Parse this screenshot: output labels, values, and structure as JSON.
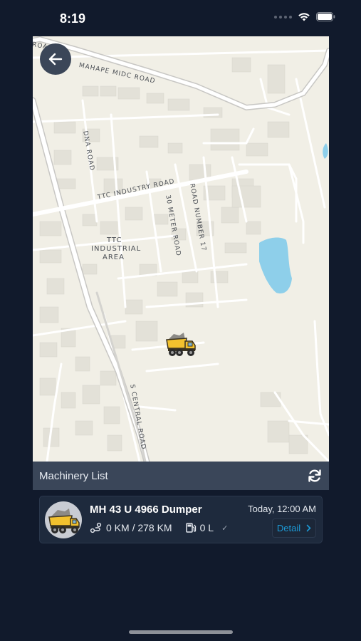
{
  "status_bar": {
    "time": "8:19"
  },
  "map": {
    "labels": {
      "top_road": "ROA",
      "mahape": "MAHAPE MIDC ROAD",
      "dna": "DNA ROAD",
      "ttc_industry": "TTC INDUSTRY ROAD",
      "thirty_meter": "30 METER ROAD",
      "road_17": "ROAD NUMBER 17",
      "area_line1": "TTC",
      "area_line2": "INDUSTRIAL",
      "area_line3": "AREA",
      "s_central": "S CENTRAL ROAD"
    },
    "marker_icon": "dumper-truck-icon"
  },
  "machinery_list": {
    "title": "Machinery List",
    "refresh_icon": "refresh-icon"
  },
  "machines": [
    {
      "name": "MH 43 U 4966 Dumper",
      "time": "Today, 12:00 AM",
      "distance": "0 KM / 278 KM",
      "fuel": "0 L",
      "detail_label": "Detail"
    }
  ],
  "colors": {
    "background": "#111a2c",
    "bar": "#3a4659",
    "card": "#1e2a3d",
    "accent": "#1c9ad6"
  }
}
